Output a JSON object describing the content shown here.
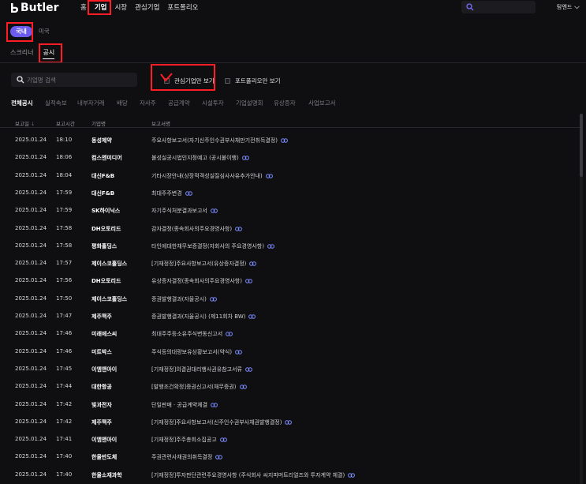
{
  "app": {
    "logo_text": "Butler",
    "nav": [
      "홈",
      "기업",
      "시장",
      "관심기업",
      "포트폴리오"
    ],
    "active_nav": "기업",
    "user_name": "탐엔드"
  },
  "market": {
    "domestic": "국내",
    "us": "미국"
  },
  "subtabs": {
    "screener": "스크리너",
    "disclosure": "공시"
  },
  "filters": {
    "search_placeholder": "기업명 검색",
    "watchlist_only": "관심기업만 보기",
    "portfolio_only": "포트폴리오만 보기"
  },
  "categories": [
    "전체공시",
    "실적속보",
    "내부자거래",
    "배당",
    "자사주",
    "공급계약",
    "시설투자",
    "기업설명회",
    "유상증자",
    "사업보고서"
  ],
  "table": {
    "headers": {
      "date": "보고일",
      "date_sort": "↓",
      "time": "보고시간",
      "company": "기업명",
      "title": "보고서명"
    },
    "rows": [
      {
        "date": "2025.01.24",
        "time": "18:10",
        "company": "동성제약",
        "title": "주요사항보고서(자기신주인수권부사채만기전취득결정)"
      },
      {
        "date": "2025.01.24",
        "time": "18:06",
        "company": "컴스엔미디어",
        "title": "불성실공시법인지정예고 (공시불이행)"
      },
      {
        "date": "2025.01.24",
        "time": "18:04",
        "company": "대신F&B",
        "title": "기타시장안내(상장적격성실질심사사유추가안내)"
      },
      {
        "date": "2025.01.24",
        "time": "17:59",
        "company": "대신F&B",
        "title": "최대주주변경"
      },
      {
        "date": "2025.01.24",
        "time": "17:59",
        "company": "SK하이닉스",
        "title": "자기주식처분결과보고서"
      },
      {
        "date": "2025.01.24",
        "time": "17:58",
        "company": "DH오토리드",
        "title": "감자결정(종속회사의주요경영사항)"
      },
      {
        "date": "2025.01.24",
        "time": "17:58",
        "company": "평화홀딩스",
        "title": "타인에대한채무보증결정(자회사의 주요경영사항)"
      },
      {
        "date": "2025.01.24",
        "time": "17:57",
        "company": "제이스코홀딩스",
        "title": "[기재정정]주요사항보고서(유상증자결정)"
      },
      {
        "date": "2025.01.24",
        "time": "17:56",
        "company": "DH오토리드",
        "title": "유상증자결정(종속회사의주요경영사항)"
      },
      {
        "date": "2025.01.24",
        "time": "17:50",
        "company": "제이스코홀딩스",
        "title": "증권발행결과(자율공시)"
      },
      {
        "date": "2025.01.24",
        "time": "17:47",
        "company": "제주맥주",
        "title": "증권발행결과(자율공시) (제11회차 BW)"
      },
      {
        "date": "2025.01.24",
        "time": "17:46",
        "company": "미래에스씨",
        "title": "최대주주등소유주식변동신고서"
      },
      {
        "date": "2025.01.24",
        "time": "17:46",
        "company": "미트박스",
        "title": "주식등의대량보유상황보고서(약식)"
      },
      {
        "date": "2025.01.24",
        "time": "17:45",
        "company": "이엠앤아이",
        "title": "[기재정정]의결권대리행사권유참고서류"
      },
      {
        "date": "2025.01.24",
        "time": "17:44",
        "company": "대한항공",
        "title": "[발행조건확정]증권신고서(채무증권)"
      },
      {
        "date": "2025.01.24",
        "time": "17:42",
        "company": "빛과전자",
        "title": "단일판매 · 공급계약체결"
      },
      {
        "date": "2025.01.24",
        "time": "17:42",
        "company": "제주맥주",
        "title": "[기재정정]주요사항보고서(신주인수권부사채권발행결정)"
      },
      {
        "date": "2025.01.24",
        "time": "17:41",
        "company": "이엠앤아이",
        "title": "[기재정정]주주총회소집공고"
      },
      {
        "date": "2025.01.24",
        "time": "17:40",
        "company": "한울반도체",
        "title": "주권관련사채권의취득결정"
      },
      {
        "date": "2025.01.24",
        "time": "17:40",
        "company": "한울소재과학",
        "title": "[기재정정]투자판단관련주요경영사항 (주식회사 씨지피머트리얼즈와 투자계약 체결)"
      }
    ]
  },
  "colors": {
    "accent": "#6b5cf0",
    "highlight_box": "#ff1d25",
    "link_icon": "#7b8cff",
    "background": "#0f0f11"
  },
  "icons": {
    "search": "search-icon",
    "link": "link-icon",
    "chevron": "chevron-down-icon",
    "check": "checkmark-icon",
    "logo": "butler-logo-icon"
  }
}
